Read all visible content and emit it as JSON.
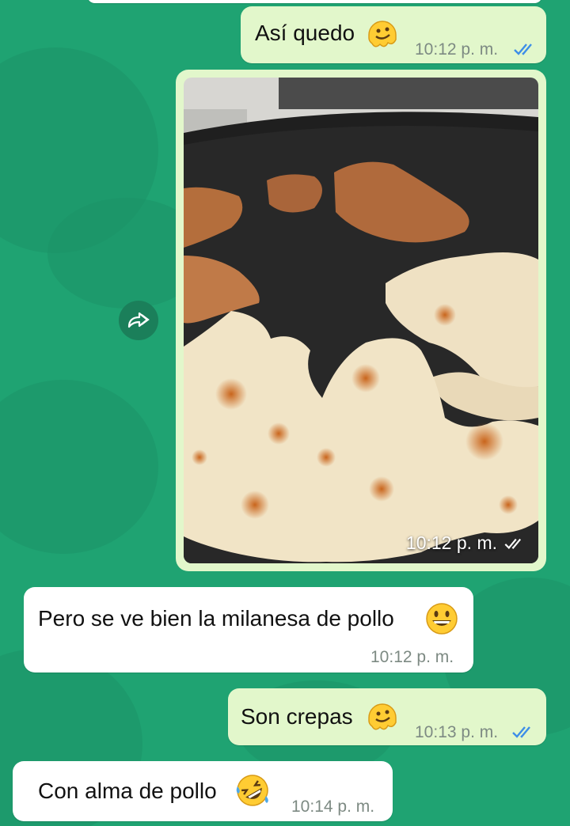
{
  "messages": [
    {
      "direction": "outgoing",
      "text": "Así quedo",
      "emoji": "melting-face",
      "time": "10:12 p. m.",
      "status": "read"
    },
    {
      "direction": "outgoing",
      "type": "image",
      "image_alt": "photo of crepes on a griddle",
      "time": "10:12 p. m.",
      "status": "read"
    },
    {
      "direction": "incoming",
      "text": "Pero se ve bien la milanesa de pollo",
      "emoji": "grinning-face",
      "time": "10:12 p. m."
    },
    {
      "direction": "outgoing",
      "text": "Son crepas",
      "emoji": "melting-face",
      "time": "10:13 p. m.",
      "status": "read"
    },
    {
      "direction": "incoming",
      "text": "Con alma de pollo",
      "emoji": "rolling-on-floor-laughing-face",
      "time": "10:14 p. m."
    }
  ],
  "colors": {
    "wallpaper": "#1fa372",
    "outgoing_bubble": "#e2f7cb",
    "incoming_bubble": "#ffffff",
    "read_ticks": "#3d8ee8"
  },
  "icons": {
    "forward": "forward-icon",
    "read_receipt": "double-check-icon"
  }
}
